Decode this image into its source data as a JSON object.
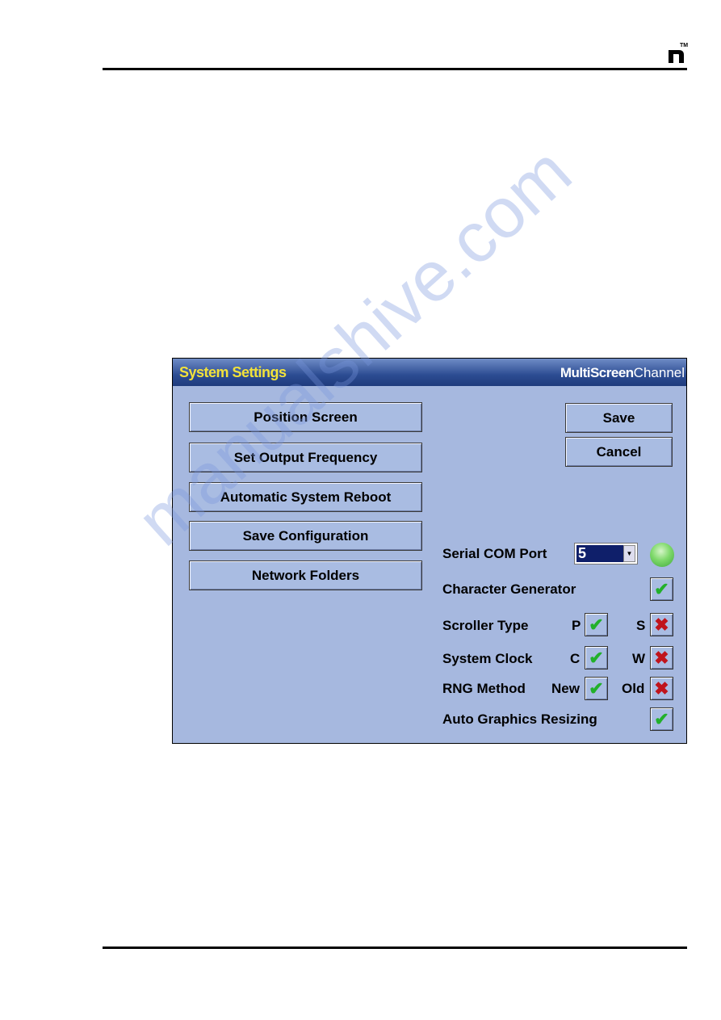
{
  "header": {
    "logo": "n",
    "trademark": "TM"
  },
  "watermark": "manualshive.com",
  "window": {
    "title": "System Settings",
    "brand_bold": "MultiScreen",
    "brand_light": "Channel"
  },
  "left_buttons": [
    "Position Screen",
    "Set Output Frequency",
    "Automatic System Reboot",
    "Save Configuration",
    "Network Folders"
  ],
  "actions": {
    "save": "Save",
    "cancel": "Cancel"
  },
  "settings": {
    "serial_com_port": {
      "label": "Serial COM Port",
      "value": "5",
      "status_color": "#7fd96b"
    },
    "character_generator": {
      "label": "Character Generator",
      "checked": true
    },
    "scroller_type": {
      "label": "Scroller Type",
      "opt1": "P",
      "opt1_checked": true,
      "opt2": "S",
      "opt2_checked": false
    },
    "system_clock": {
      "label": "System Clock",
      "opt1": "C",
      "opt1_checked": true,
      "opt2": "W",
      "opt2_checked": false
    },
    "rng_method": {
      "label": "RNG Method",
      "opt1": "New",
      "opt1_checked": true,
      "opt2": "Old",
      "opt2_checked": false
    },
    "auto_graphics_resizing": {
      "label": "Auto Graphics Resizing",
      "checked": true
    }
  },
  "icons": {
    "check": "✔",
    "cross": "✖",
    "dropdown": "▼"
  }
}
